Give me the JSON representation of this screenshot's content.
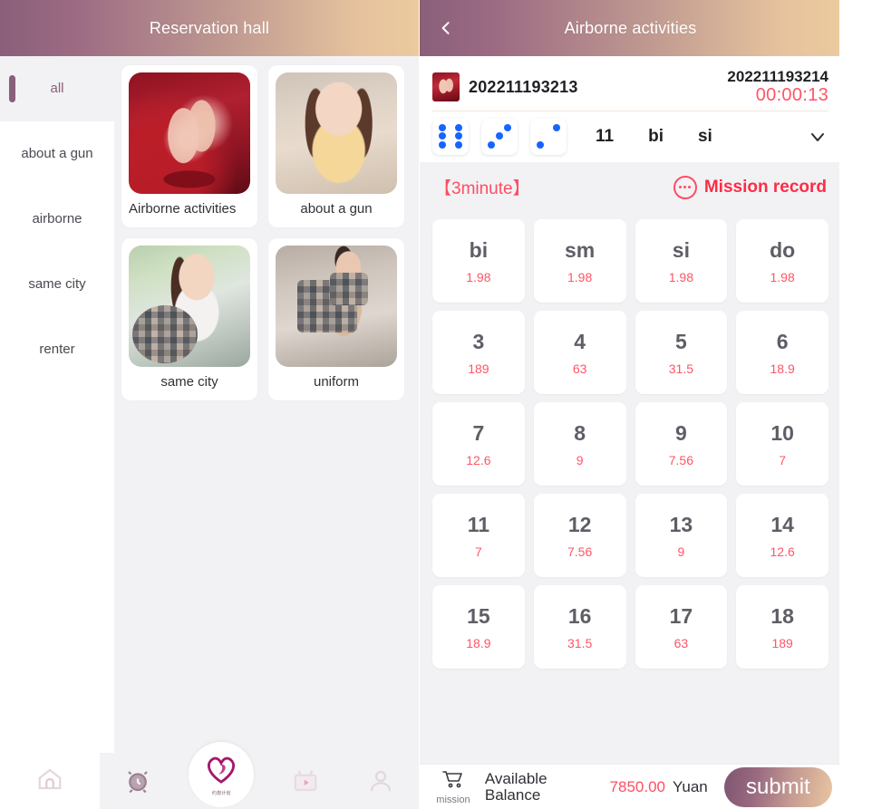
{
  "left": {
    "header": {
      "title": "Reservation hall"
    },
    "categories": [
      {
        "label": "all",
        "active": true
      },
      {
        "label": "about a gun",
        "active": false
      },
      {
        "label": "airborne",
        "active": false
      },
      {
        "label": "same city",
        "active": false
      },
      {
        "label": "renter",
        "active": false
      }
    ],
    "cards": [
      {
        "title": "Airborne activities",
        "thumb": "party-room-photo",
        "censored": false
      },
      {
        "title": "about a gun",
        "thumb": "portrait-photo",
        "censored": false
      },
      {
        "title": "same city",
        "thumb": "car-seat-photo",
        "censored": true
      },
      {
        "title": "uniform",
        "thumb": "indoor-photo",
        "censored": true
      }
    ],
    "bottom_nav": [
      {
        "icon": "home-icon",
        "label": ""
      },
      {
        "icon": "alarm-clock-icon",
        "label": ""
      },
      {
        "icon": "heart-logo-icon",
        "label": "约炮计划"
      },
      {
        "icon": "video-play-icon",
        "label": ""
      },
      {
        "icon": "person-icon",
        "label": ""
      }
    ]
  },
  "right": {
    "header": {
      "title": "Airborne activities",
      "back_icon": "chevron-left-icon"
    },
    "issue": {
      "current_number": "202211193213",
      "next_number": "202211193214",
      "countdown": "00:00:13"
    },
    "dice": {
      "values": [
        6,
        3,
        2
      ],
      "sum": "11",
      "tags": [
        "bi",
        "si"
      ],
      "expand_icon": "chevron-down-icon"
    },
    "record_bar": {
      "duration": "【3minute】",
      "record_label": "Mission record",
      "record_icon": "dots-circle-icon"
    },
    "bets": [
      {
        "name": "bi",
        "odds": "1.98"
      },
      {
        "name": "sm",
        "odds": "1.98"
      },
      {
        "name": "si",
        "odds": "1.98"
      },
      {
        "name": "do",
        "odds": "1.98"
      },
      {
        "name": "3",
        "odds": "189"
      },
      {
        "name": "4",
        "odds": "63"
      },
      {
        "name": "5",
        "odds": "31.5"
      },
      {
        "name": "6",
        "odds": "18.9"
      },
      {
        "name": "7",
        "odds": "12.6"
      },
      {
        "name": "8",
        "odds": "9"
      },
      {
        "name": "9",
        "odds": "7.56"
      },
      {
        "name": "10",
        "odds": "7"
      },
      {
        "name": "11",
        "odds": "7"
      },
      {
        "name": "12",
        "odds": "7.56"
      },
      {
        "name": "13",
        "odds": "9"
      },
      {
        "name": "14",
        "odds": "12.6"
      },
      {
        "name": "15",
        "odds": "18.9"
      },
      {
        "name": "16",
        "odds": "31.5"
      },
      {
        "name": "17",
        "odds": "63"
      },
      {
        "name": "18",
        "odds": "189"
      }
    ],
    "pay_bar": {
      "cart_icon": "cart-icon",
      "cart_label": "mission",
      "balance_label": "Available Balance",
      "balance_amount": "7850.00",
      "balance_unit": "Yuan",
      "submit_label": "submit"
    }
  },
  "colors": {
    "header_gradient_start": "#8a5f7a",
    "header_gradient_end": "#ecca9f",
    "accent_red": "#ff4d63",
    "pip_blue": "#1565ff",
    "panel_bg": "#f2f2f4"
  }
}
